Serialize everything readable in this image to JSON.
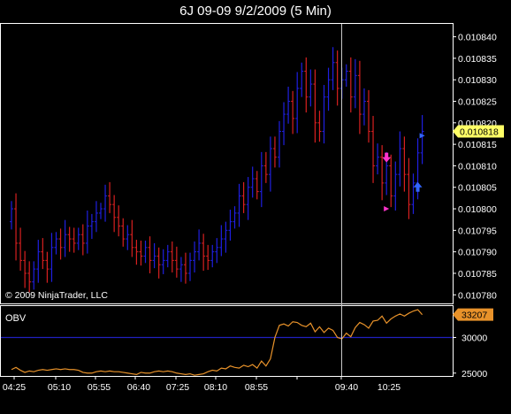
{
  "window": {
    "title": "6J 09-09  9/2/2009 (5 Min)"
  },
  "copyright": "© 2009 NinjaTrader, LLC",
  "colors": {
    "background": "#000000",
    "up": "#1f1fe0",
    "down": "#d82020",
    "axis_text": "#ffffff",
    "price_marker": "#ffff66",
    "obv_line": "#e8922a",
    "obv_ref_line": "#2020c0",
    "crosshair": "#c8c8c8",
    "signal_down": "#ff33cc",
    "signal_up": "#3366ff"
  },
  "chart_data": [
    {
      "type": "candlestick",
      "title": "6J 09-09  9/2/2009 (5 Min)",
      "y_ticks": [
        "0.010840",
        "0.010835",
        "0.010830",
        "0.010825",
        "0.010820",
        "0.010815",
        "0.010810",
        "0.010805",
        "0.010800",
        "0.010795",
        "0.010790",
        "0.010785",
        "0.010780"
      ],
      "ylim": [
        0.010778,
        0.010843
      ],
      "last_price_label": "0.010818",
      "last_price": 0.010818,
      "bar_count": 93,
      "bars_close": [
        0.0108,
        0.010792,
        0.010788,
        0.010785,
        0.010783,
        0.010786,
        0.01079,
        0.010788,
        0.010786,
        0.010791,
        0.010793,
        0.010791,
        0.010794,
        0.010793,
        0.010792,
        0.010794,
        0.010792,
        0.010796,
        0.010797,
        0.010799,
        0.0108,
        0.010803,
        0.010801,
        0.010798,
        0.010796,
        0.010793,
        0.010794,
        0.010791,
        0.01079,
        0.010789,
        0.010791,
        0.010788,
        0.010789,
        0.010787,
        0.010788,
        0.01079,
        0.010788,
        0.010786,
        0.010787,
        0.010785,
        0.010788,
        0.01079,
        0.010792,
        0.010789,
        0.010788,
        0.01079,
        0.010791,
        0.010793,
        0.010795,
        0.010797,
        0.010799,
        0.010803,
        0.010801,
        0.010805,
        0.010807,
        0.010804,
        0.01081,
        0.010808,
        0.010814,
        0.010812,
        0.010818,
        0.010822,
        0.010825,
        0.010821,
        0.010828,
        0.010832,
        0.010826,
        0.010829,
        0.01082,
        0.010818,
        0.010826,
        0.01083,
        0.010834,
        0.010828,
        0.01083,
        0.010832,
        0.010826,
        0.010831,
        0.010822,
        0.010825,
        0.010818,
        0.01081,
        0.010812,
        0.010806,
        0.01081,
        0.010803,
        0.010808,
        0.010814,
        0.010808,
        0.010801,
        0.010806,
        0.010813,
        0.010818
      ],
      "signals": [
        {
          "type": "down-arrow",
          "bar": 84,
          "price": 0.010811
        },
        {
          "type": "marker",
          "bar": 84,
          "price": 0.0108
        },
        {
          "type": "up-arrow",
          "bar": 91,
          "price": 0.010805
        },
        {
          "type": "marker",
          "bar": 92,
          "price": 0.010817
        }
      ]
    },
    {
      "type": "line",
      "name": "OBV",
      "y_ticks": [
        "30000",
        "25000"
      ],
      "ylim": [
        24600,
        34400
      ],
      "reference_value": 30000,
      "last_value_label": "33207",
      "values": [
        25500,
        25800,
        25400,
        25100,
        25300,
        25200,
        25400,
        25500,
        25400,
        25500,
        25600,
        25500,
        25600,
        25500,
        25500,
        25400,
        25100,
        25000,
        25000,
        25200,
        25300,
        25200,
        25300,
        25200,
        25200,
        25100,
        25000,
        24900,
        24800,
        25100,
        25000,
        25000,
        25200,
        25300,
        25200,
        25300,
        25200,
        25000,
        24900,
        24800,
        24900,
        24700,
        24800,
        24900,
        25200,
        25400,
        25300,
        25700,
        25600,
        26000,
        25800,
        25700,
        26100,
        25900,
        26200,
        25700,
        26700,
        26000,
        27000,
        30000,
        31700,
        31900,
        31600,
        32200,
        32100,
        31700,
        31500,
        32000,
        30800,
        31500,
        30700,
        31300,
        31000,
        30000,
        29800,
        30600,
        30100,
        31400,
        32100,
        31800,
        31300,
        32300,
        32400,
        33000,
        32000,
        32600,
        33000,
        33300,
        33000,
        33400,
        33700,
        33900,
        33200
      ]
    }
  ],
  "x_ticks": [
    "04:25",
    "05:10",
    "05:55",
    "06:40",
    "07:25",
    "08:10",
    "08:55",
    "09:40",
    "10:25"
  ],
  "panel_label": "OBV"
}
